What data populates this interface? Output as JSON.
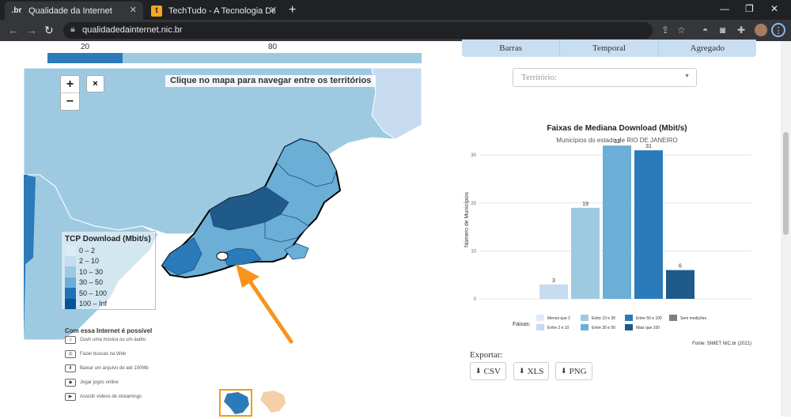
{
  "browser": {
    "tabs": [
      {
        "title": "Qualidade da Internet",
        "favicon": ".br"
      },
      {
        "title": "TechTudo - A Tecnologia Descom",
        "favicon": "tt"
      }
    ],
    "url": "qualidadedainternet.nic.br"
  },
  "scale": {
    "label_low": "20",
    "label_high": "80",
    "fill_fraction": 0.2
  },
  "map": {
    "zoom_in": "+",
    "zoom_out": "−",
    "close": "×",
    "hint": "Clique no mapa para navegar entre os territórios",
    "legend": {
      "title": "TCP Download (Mbit/s)",
      "items": [
        {
          "label": "0 – 2",
          "color": "#deebf7"
        },
        {
          "label": "2 – 10",
          "color": "#c6dbef"
        },
        {
          "label": "10 – 30",
          "color": "#9ecae1"
        },
        {
          "label": "30 – 50",
          "color": "#6baed6"
        },
        {
          "label": "50 – 100",
          "color": "#2171b5"
        },
        {
          "label": "100 – Inf",
          "color": "#08519c"
        }
      ]
    }
  },
  "possible": {
    "title": "Com essa Internet é possível",
    "items": [
      {
        "label": "Ouvir uma música ou um áudio",
        "icon": "headphones-icon"
      },
      {
        "label": "Fazer buscas na Web",
        "icon": "web-search-icon"
      },
      {
        "label": "Baixar um arquivo de até 100Mb",
        "icon": "download-icon"
      },
      {
        "label": "Jogar jogos online",
        "icon": "gamepad-icon"
      },
      {
        "label": "Assistir vídeos de streamings",
        "icon": "video-icon"
      }
    ]
  },
  "view_tabs": [
    "Barras",
    "Temporal",
    "Agregado"
  ],
  "territory_select": {
    "placeholder": "Território:"
  },
  "chart_data": {
    "type": "bar",
    "title": "Faixas de Mediana Download (Mbit/s)",
    "subtitle": "Municípios do estado de RIO DE JANEIRO",
    "ylabel": "Número de Municípios",
    "ylim": [
      0,
      33
    ],
    "yticks": [
      0,
      10,
      20,
      30
    ],
    "categories": [
      "Entre 2 e 10",
      "Entre 10 e 30",
      "Entre 30 e 50",
      "Entre 50 e 100",
      "Mais que 100"
    ],
    "values": [
      3,
      19,
      32,
      31,
      6
    ],
    "colors": [
      "#c6dbef",
      "#9ecae1",
      "#6baed6",
      "#2b7bba",
      "#1f5a8a"
    ],
    "legend_title": "Faixas:",
    "legend": [
      {
        "label": "Menos que 2",
        "color": "#deebf7"
      },
      {
        "label": "Entre 2 e 10",
        "color": "#c6dbef"
      },
      {
        "label": "Entre 10 e 30",
        "color": "#9ecae1"
      },
      {
        "label": "Entre 30 e 50",
        "color": "#6baed6"
      },
      {
        "label": "Entre 50 e 100",
        "color": "#2b7bba"
      },
      {
        "label": "Mais que 100",
        "color": "#1f5a8a"
      },
      {
        "label": "Sem medições",
        "color": "#808080"
      }
    ],
    "source": "Fonte: SIMET NIC.br (2021)"
  },
  "export": {
    "title": "Exportar:",
    "csv": "CSV",
    "xls": "XLS",
    "png": "PNG"
  }
}
